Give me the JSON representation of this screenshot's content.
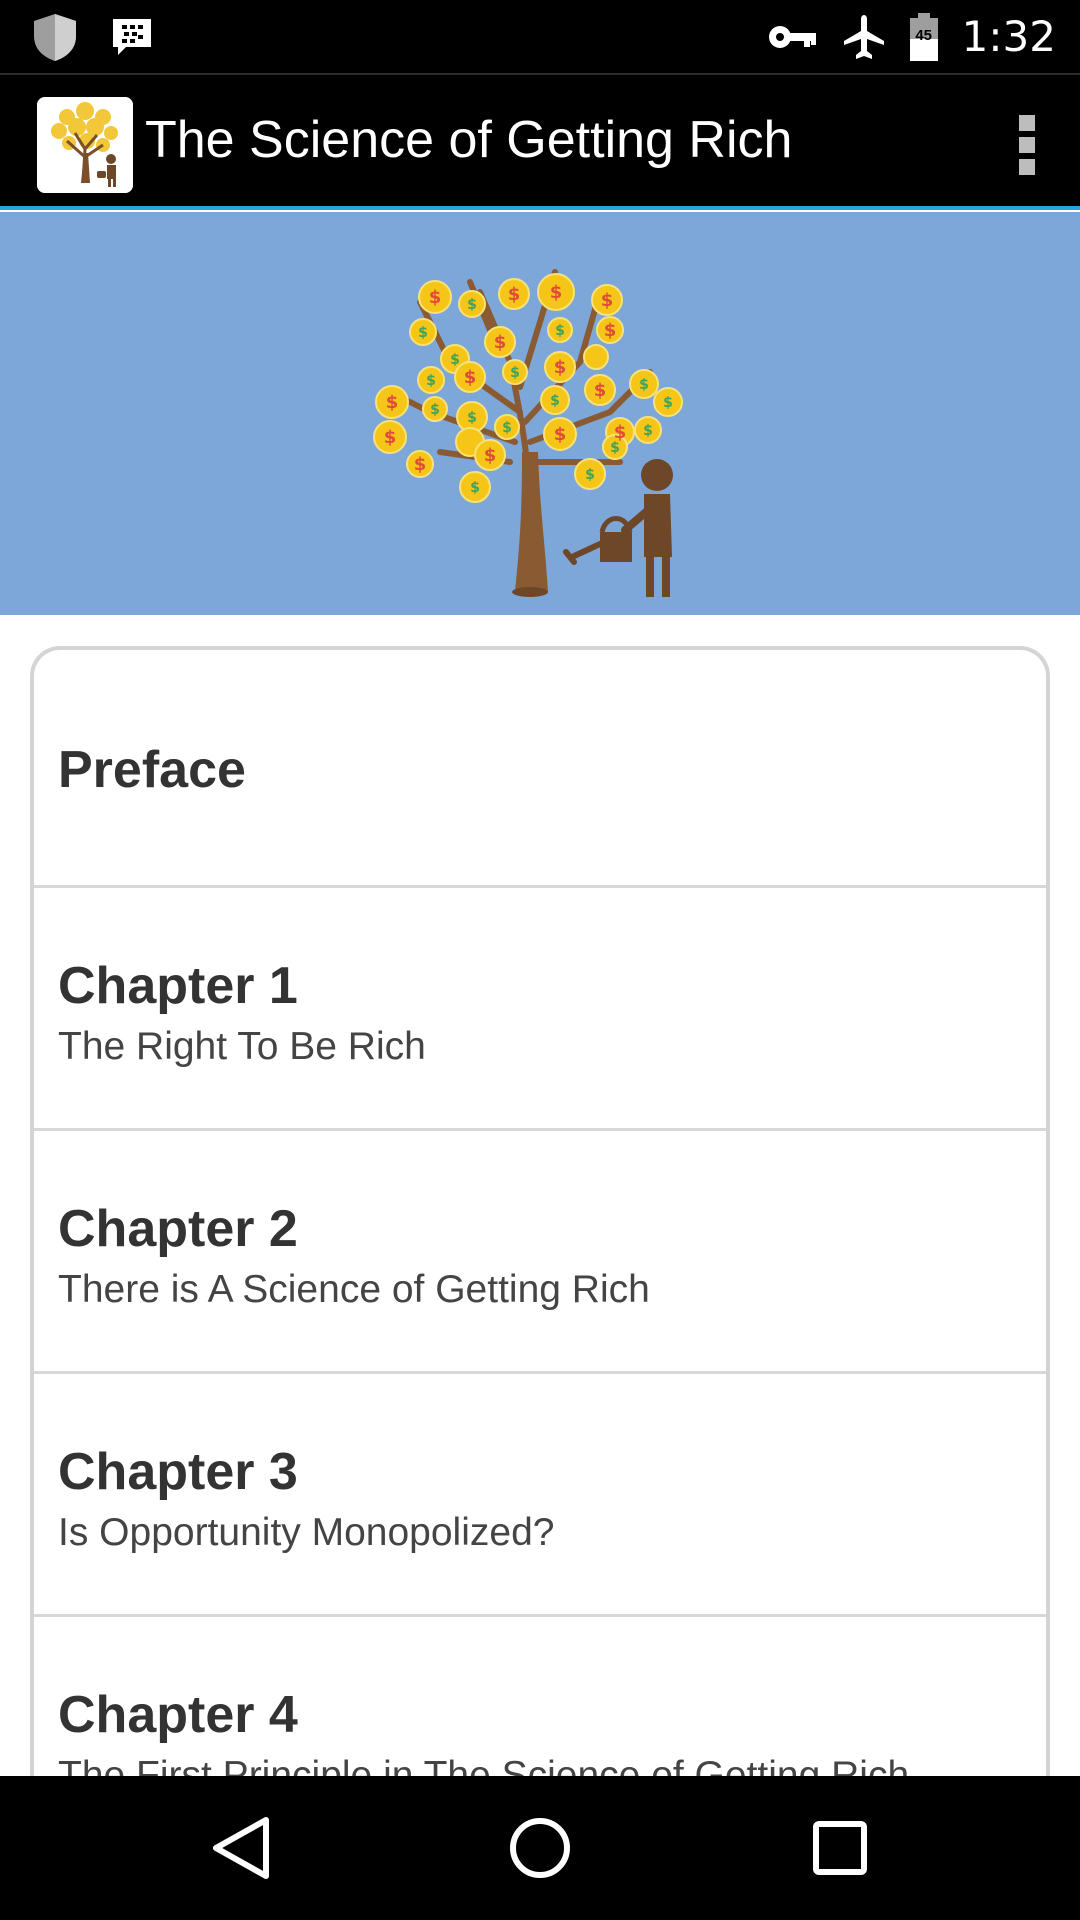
{
  "status_bar": {
    "time": "1:32",
    "battery_level": "45",
    "icons": [
      "shield-icon",
      "blackberry-messenger-icon",
      "vpn-key-icon",
      "airplane-mode-icon",
      "battery-icon"
    ]
  },
  "app_bar": {
    "title": "The Science of Getting Rich",
    "menu_icon": "overflow-menu-icon"
  },
  "banner": {
    "image": "money-tree-with-gardener-illustration",
    "background_color": "#7da7d9"
  },
  "chapters": [
    {
      "title": "Preface",
      "subtitle": ""
    },
    {
      "title": "Chapter 1",
      "subtitle": "The Right To Be Rich"
    },
    {
      "title": "Chapter 2",
      "subtitle": "There is A Science of Getting Rich"
    },
    {
      "title": "Chapter 3",
      "subtitle": "Is Opportunity Monopolized?"
    },
    {
      "title": "Chapter 4",
      "subtitle": "The First Principle in The Science of Getting Rich"
    }
  ],
  "nav_bar": {
    "buttons": [
      "back-icon",
      "home-icon",
      "recents-icon"
    ]
  },
  "colors": {
    "accent": "#2fa3d9",
    "banner": "#7da7d9",
    "tree_trunk": "#7a4f2a",
    "leaf_yellow": "#f5c518"
  }
}
